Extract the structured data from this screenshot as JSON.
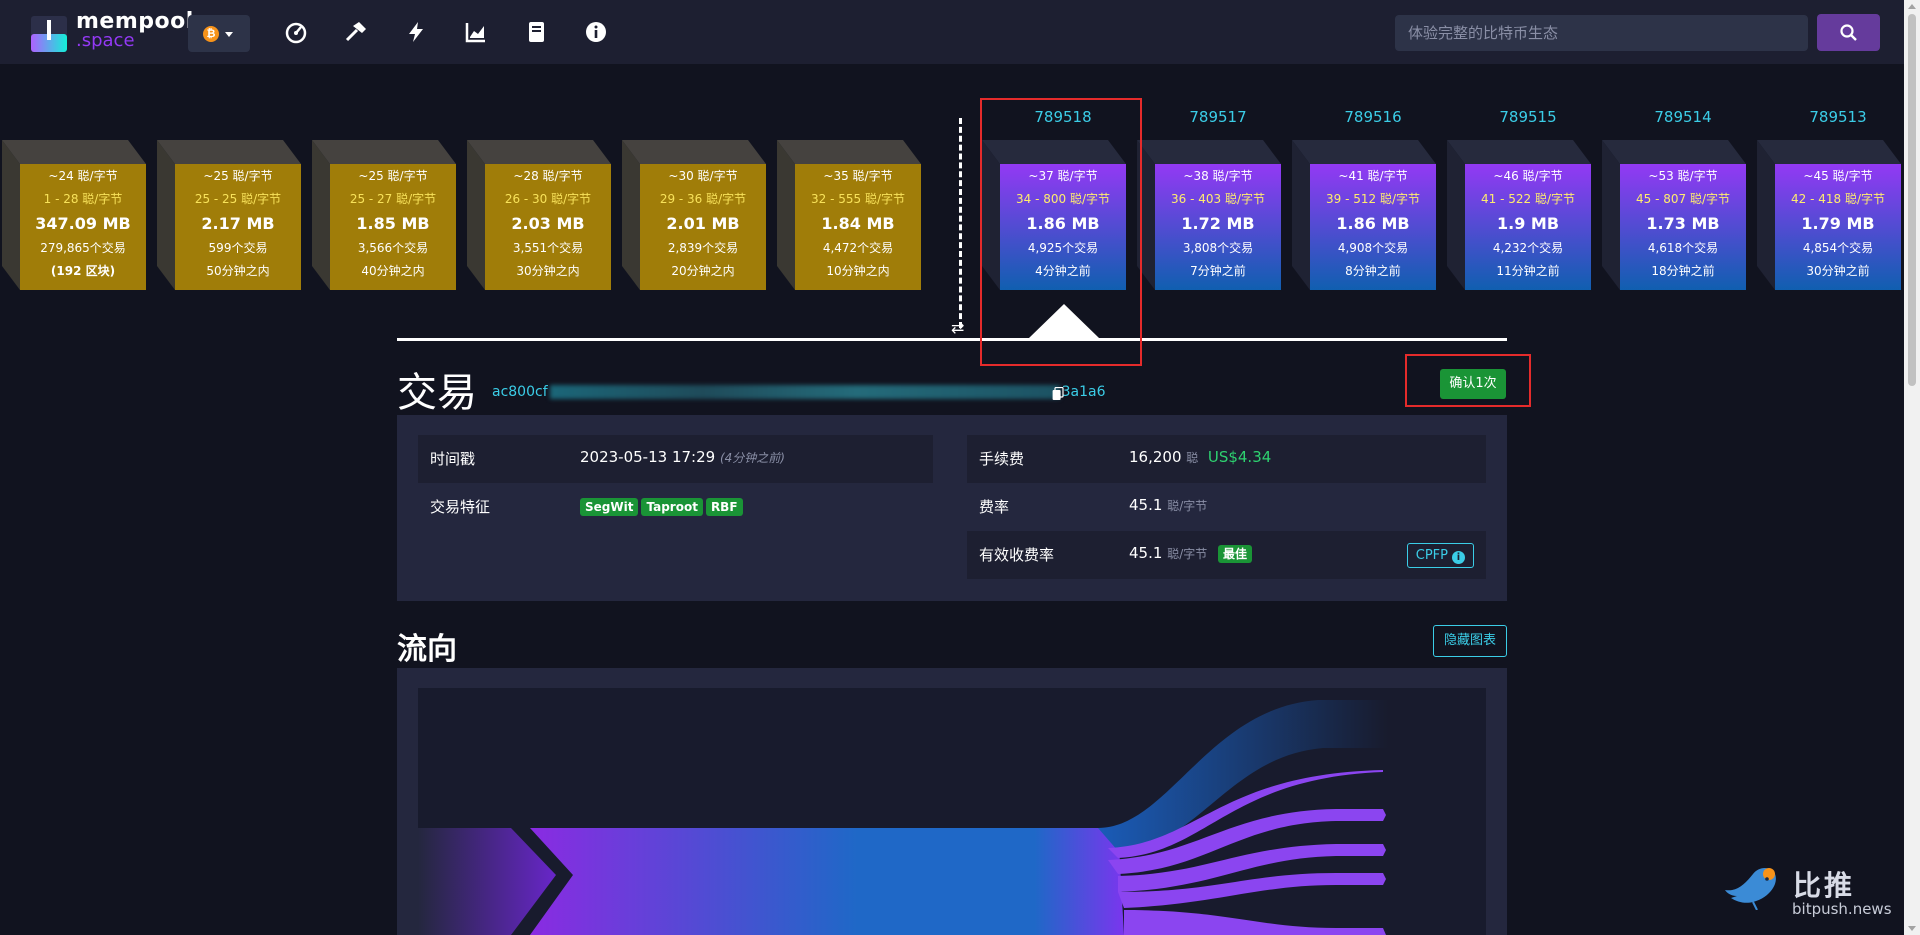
{
  "nav": {
    "logo_line1": "mempool",
    "logo_line2": ".space",
    "network_symbol": "₿",
    "icons": [
      "dashboard-icon",
      "mining-hammer-icon",
      "lightning-icon",
      "graphs-icon",
      "docs-book-icon",
      "about-info-icon"
    ],
    "search_placeholder": "体验完整的比特币生态"
  },
  "mempool_blocks": [
    {
      "fee": "~24 聪/字节",
      "range": "1 - 28 聪/字节",
      "size": "347.09 MB",
      "tx": "279,865个交易",
      "time": "(192 区块)"
    },
    {
      "fee": "~25 聪/字节",
      "range": "25 - 25 聪/字节",
      "size": "2.17 MB",
      "tx": "599个交易",
      "time": "50分钟之内"
    },
    {
      "fee": "~25 聪/字节",
      "range": "25 - 27 聪/字节",
      "size": "1.85 MB",
      "tx": "3,566个交易",
      "time": "40分钟之内"
    },
    {
      "fee": "~28 聪/字节",
      "range": "26 - 30 聪/字节",
      "size": "2.03 MB",
      "tx": "3,551个交易",
      "time": "30分钟之内"
    },
    {
      "fee": "~30 聪/字节",
      "range": "29 - 36 聪/字节",
      "size": "2.01 MB",
      "tx": "2,839个交易",
      "time": "20分钟之内"
    },
    {
      "fee": "~35 聪/字节",
      "range": "32 - 555 聪/字节",
      "size": "1.84 MB",
      "tx": "4,472个交易",
      "time": "10分钟之内"
    }
  ],
  "confirmed_blocks": [
    {
      "height": "789518",
      "fee": "~37 聪/字节",
      "range": "34 - 800 聪/字节",
      "size": "1.86 MB",
      "tx": "4,925个交易",
      "time": "4分钟之前"
    },
    {
      "height": "789517",
      "fee": "~38 聪/字节",
      "range": "36 - 403 聪/字节",
      "size": "1.72 MB",
      "tx": "3,808个交易",
      "time": "7分钟之前"
    },
    {
      "height": "789516",
      "fee": "~41 聪/字节",
      "range": "39 - 512 聪/字节",
      "size": "1.86 MB",
      "tx": "4,908个交易",
      "time": "8分钟之前"
    },
    {
      "height": "789515",
      "fee": "~46 聪/字节",
      "range": "41 - 522 聪/字节",
      "size": "1.9 MB",
      "tx": "4,232个交易",
      "time": "11分钟之前"
    },
    {
      "height": "789514",
      "fee": "~53 聪/字节",
      "range": "45 - 807 聪/字节",
      "size": "1.73 MB",
      "tx": "4,618个交易",
      "time": "18分钟之前"
    },
    {
      "height": "789513",
      "fee": "~45 聪/字节",
      "range": "42 - 418 聪/字节",
      "size": "1.79 MB",
      "tx": "4,854个交易",
      "time": "30分钟之前"
    }
  ],
  "tx": {
    "title": "交易",
    "txid_start": "ac800cf",
    "txid_end": "3a1a6",
    "confirm_label": "确认1次",
    "timestamp_label": "时间戳",
    "timestamp_value": "2023-05-13 17:29",
    "timestamp_rel": "(4分钟之前)",
    "features_label": "交易特征",
    "features": [
      "SegWit",
      "Taproot",
      "RBF"
    ],
    "fee_label": "手续费",
    "fee_value": "16,200",
    "fee_unit": "聪",
    "fee_usd": "US$4.34",
    "rate_label": "费率",
    "rate_value": "45.1",
    "rate_unit": "聪/字节",
    "eff_label": "有效收费率",
    "eff_value": "45.1",
    "eff_unit": "聪/字节",
    "eff_badge": "最佳",
    "cpfp_label": "CPFP"
  },
  "flow": {
    "title": "流向",
    "hide_label": "隐藏图表"
  },
  "watermark": {
    "cn": "比推",
    "en": "bitpush.news"
  },
  "colors": {
    "background": "#11131f",
    "nav": "#1d1f31",
    "accent_purple": "#9339f4",
    "link_cyan": "#3bcde7",
    "green": "#1a9436",
    "mempool_block": "#a07d09",
    "highlight_red": "#e52b2b"
  }
}
